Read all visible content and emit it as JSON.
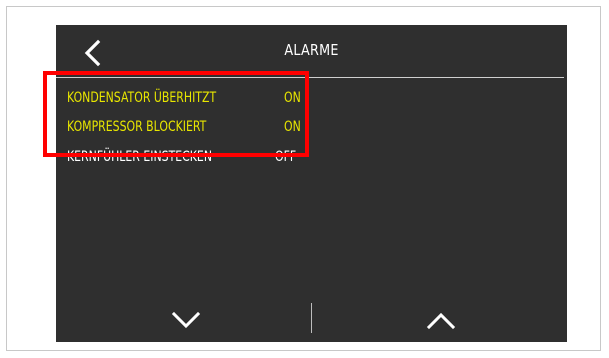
{
  "screen": {
    "title": "ALARME",
    "back_icon": "chevron-left-icon",
    "alarms": [
      {
        "name": "KONDENSATOR ÜBERHITZT",
        "state": "ON",
        "active": true
      },
      {
        "name": "KOMPRESSOR BLOCKIERT",
        "state": "ON",
        "active": true
      },
      {
        "name": "KERNFÜHLER EINSTECKEN",
        "state": "OFF",
        "active": false
      }
    ],
    "nav": {
      "down_icon": "chevron-down-icon",
      "up_icon": "chevron-up-icon"
    }
  },
  "colors": {
    "screen_bg": "#2f2f2f",
    "active_text": "#e8e600",
    "inactive_text": "#ffffff",
    "highlight": "#ff0000"
  }
}
